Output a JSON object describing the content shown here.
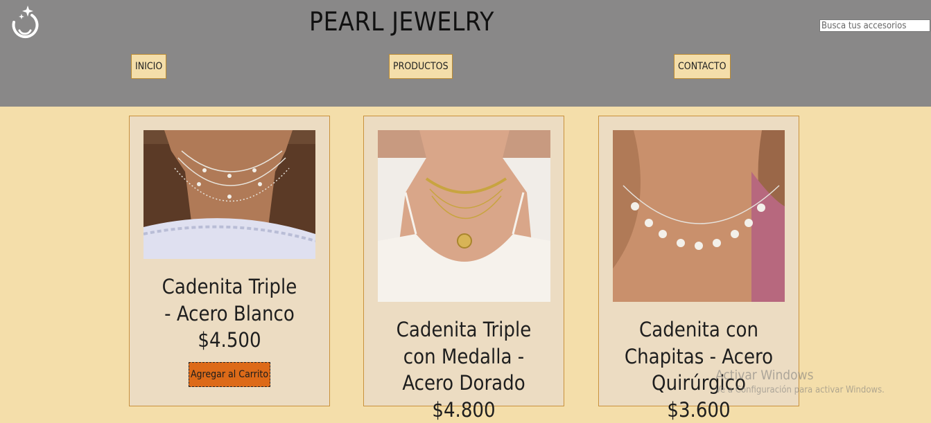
{
  "header": {
    "title": "PEARL JEWELRY",
    "search_placeholder": "Busca tus accesorios",
    "nav": [
      {
        "label": "INICIO"
      },
      {
        "label": "PRODUCTOS"
      },
      {
        "label": "CONTACTO"
      }
    ],
    "logo_icon": "moon-stars-icon"
  },
  "products": [
    {
      "name": "Cadenita Triple - Acero Blanco",
      "price": "$4.500",
      "button_label": "Agregar al Carrito"
    },
    {
      "name": "Cadenita Triple con Medalla - Acero Dorado",
      "price": "$4.800"
    },
    {
      "name": "Cadenita con Chapitas - Acero Quirúrgico",
      "price": "$3.600"
    }
  ],
  "watermark": {
    "line1": "Activar Windows",
    "line2": "Ve a Configuración para activar Windows."
  },
  "colors": {
    "header_bg": "#898888",
    "page_bg": "#f4deaa",
    "card_bg": "#ecdcc2",
    "card_border": "#c8913c",
    "button_bg": "#dd6a18"
  }
}
